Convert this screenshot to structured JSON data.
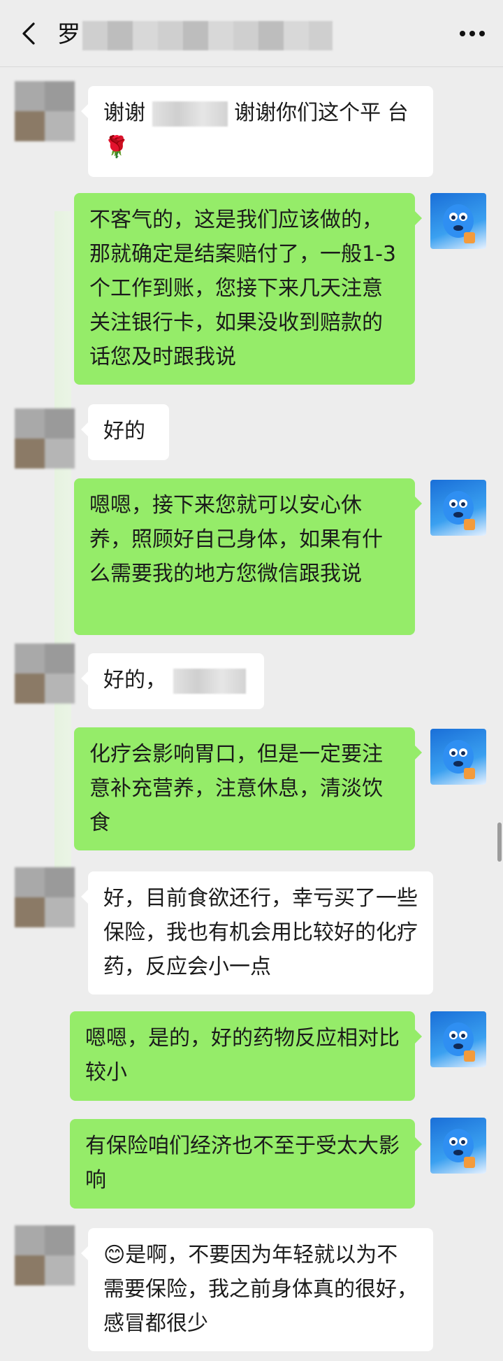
{
  "header": {
    "title": "罗"
  },
  "messages": [
    {
      "side": "left",
      "text": "谢谢 [redacted] 谢谢你们这个平台",
      "emoji": "🌹"
    },
    {
      "side": "right",
      "text": "不客气的，这是我们应该做的，那就确定是结案赔付了，一般1-3个工作到账，您接下来几天注意关注银行卡，如果没收到赔款的话您及时跟我说"
    },
    {
      "side": "left",
      "text": "好的"
    },
    {
      "side": "right",
      "text": "嗯嗯，接下来您就可以安心休养，照顾好自己身体，如果有什么需要我的地方您微信跟我说"
    },
    {
      "side": "left",
      "text": "好的，"
    },
    {
      "side": "right",
      "text": "化疗会影响胃口，但是一定要注意补充营养，注意休息，清淡饮食"
    },
    {
      "side": "left",
      "text": "好，目前食欲还行，幸亏买了一些保险，我也有机会用比较好的化疗药，反应会小一点"
    },
    {
      "side": "right",
      "text": "嗯嗯，是的，好的药物反应相对比较小"
    },
    {
      "side": "right",
      "text": "有保险咱们经济也不至于受太大影响"
    },
    {
      "side": "left",
      "text": "是啊，不要因为年轻就以为不需要保险，我之前身体真的很好，感冒都很少",
      "emoji": "😊"
    }
  ],
  "msg_parts": {
    "m0_a": "谢谢",
    "m0_b": "谢谢你们这个平",
    "m0_c": "台",
    "m0_emoji": "🌹",
    "m9_emoji": "😊",
    "m9_text": "是啊，不要因为年轻就以为不需要保险，我之前身体真的很好，感冒都很少"
  },
  "colors": {
    "background": "#ededed",
    "bubble_self": "#95ec69",
    "bubble_other": "#ffffff"
  },
  "icons": {
    "back": "chevron-left-icon",
    "more": "more-dots-icon"
  }
}
